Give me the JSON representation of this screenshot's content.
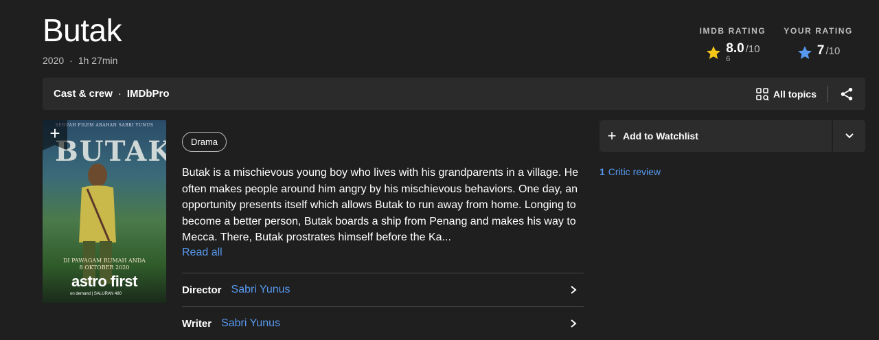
{
  "header": {
    "title": "Butak",
    "year": "2020",
    "separator": "·",
    "runtime": "1h 27min"
  },
  "ratings": {
    "imdb": {
      "label": "IMDb RATING",
      "score": "8.0",
      "denominator": "/10",
      "count": "6",
      "star_color": "#f5c518"
    },
    "yours": {
      "label": "YOUR RATING",
      "score": "7",
      "denominator": "/10",
      "star_color": "#5799ef"
    }
  },
  "subnav": {
    "cast_crew": "Cast & crew",
    "dot": "·",
    "imdbpro": "IMDbPro",
    "all_topics": "All topics",
    "share_icon": "share-icon"
  },
  "poster": {
    "top_text": "SEBUAH FILEM ARAHAN SABRI YUNUS",
    "title_text": "BUTAK",
    "date_line1": "DI PAWAGAM RUMAH ANDA",
    "date_line2": "8 OKTOBER 2020",
    "brand": "astro first",
    "sub": "on demand  |  SALURAN 480",
    "add_symbol": "+"
  },
  "main": {
    "genre": "Drama",
    "plot": "Butak is a mischievous young boy who lives with his grandparents in a village. He often makes people around him angry by his mischievous behaviors. One day, an opportunity presents itself which allows Butak to run away from home. Longing to become a better person, Butak boards a ship from Penang and makes his way to Mecca. There, Butak prostrates himself before the Ka...",
    "read_all": "Read all",
    "credits": [
      {
        "label": "Director",
        "value": "Sabri Yunus"
      },
      {
        "label": "Writer",
        "value": "Sabri Yunus"
      }
    ]
  },
  "side": {
    "watchlist_plus": "+",
    "watchlist_label": "Add to Watchlist",
    "critic_count": "1",
    "critic_label": "Critic review"
  },
  "colors": {
    "background": "#1f1f1f",
    "link": "#5799ef",
    "accent_gold": "#f5c518"
  }
}
